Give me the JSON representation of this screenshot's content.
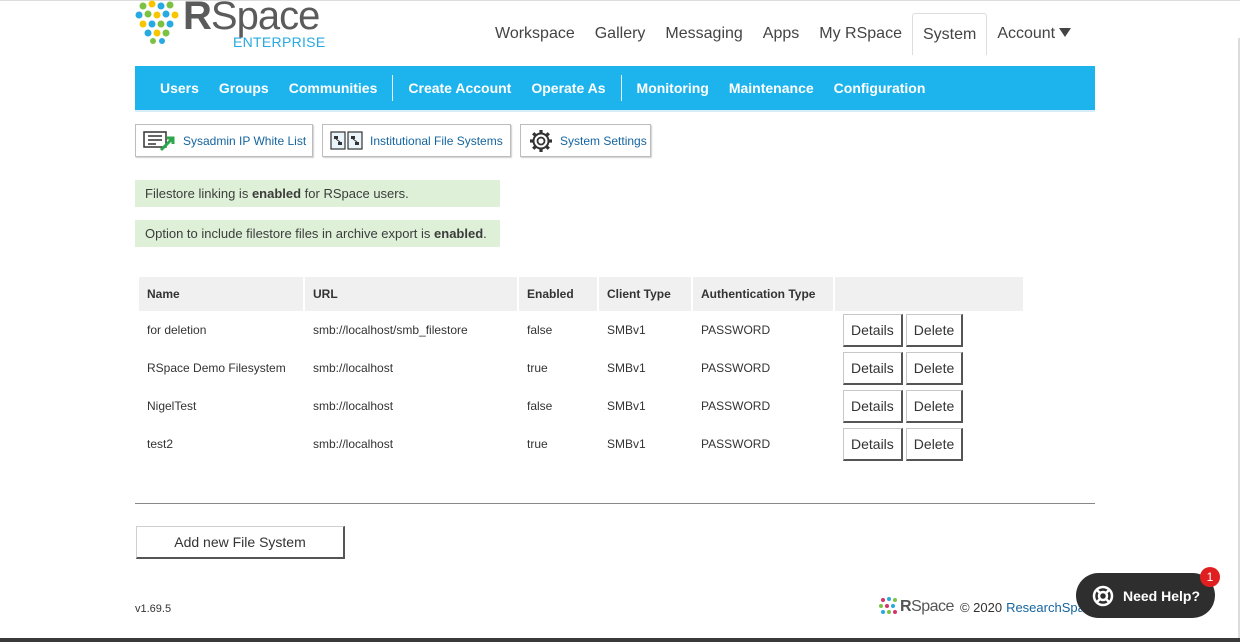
{
  "header": {
    "logo_word_bold": "R",
    "logo_word_rest": "Space",
    "logo_sub": "ENTERPRISE",
    "nav": [
      {
        "label": "Workspace"
      },
      {
        "label": "Gallery"
      },
      {
        "label": "Messaging"
      },
      {
        "label": "Apps"
      },
      {
        "label": "My RSpace"
      },
      {
        "label": "System",
        "active": true
      },
      {
        "label": "Account"
      }
    ]
  },
  "subnav": {
    "group1": [
      "Users",
      "Groups",
      "Communities"
    ],
    "group2": [
      "Create Account",
      "Operate As"
    ],
    "group3": [
      "Monitoring",
      "Maintenance",
      "Configuration"
    ]
  },
  "tools": {
    "ip_whitelist": "Sysadmin IP White List",
    "file_systems": "Institutional File Systems",
    "settings": "System Settings"
  },
  "alerts": {
    "linking_pre": "Filestore linking is ",
    "linking_bold": "enabled",
    "linking_post": " for RSpace users.",
    "export_pre": "Option to include filestore files in archive export is ",
    "export_bold": "enabled",
    "export_post": "."
  },
  "table": {
    "headers": [
      "Name",
      "URL",
      "Enabled",
      "Client Type",
      "Authentication Type"
    ],
    "rows": [
      {
        "name": "for deletion",
        "url": "smb://localhost/smb_filestore",
        "enabled": "false",
        "client": "SMBv1",
        "auth": "PASSWORD"
      },
      {
        "name": "RSpace Demo Filesystem",
        "url": "smb://localhost",
        "enabled": "true",
        "client": "SMBv1",
        "auth": "PASSWORD"
      },
      {
        "name": "NigelTest",
        "url": "smb://localhost",
        "enabled": "false",
        "client": "SMBv1",
        "auth": "PASSWORD"
      },
      {
        "name": "test2",
        "url": "smb://localhost",
        "enabled": "true",
        "client": "SMBv1",
        "auth": "PASSWORD"
      }
    ],
    "details_label": "Details",
    "delete_label": "Delete"
  },
  "add_button": "Add new File System",
  "footer": {
    "version": "v1.69.5",
    "rs_bold": "R",
    "rs_rest": "Space",
    "copyright": "© 2020",
    "company": "ResearchSpace"
  },
  "help": {
    "label": "Need Help?",
    "badge": "1"
  },
  "colors": {
    "accent": "#1db4ee",
    "link": "#1565a0",
    "alert_bg": "#dff0d8"
  }
}
